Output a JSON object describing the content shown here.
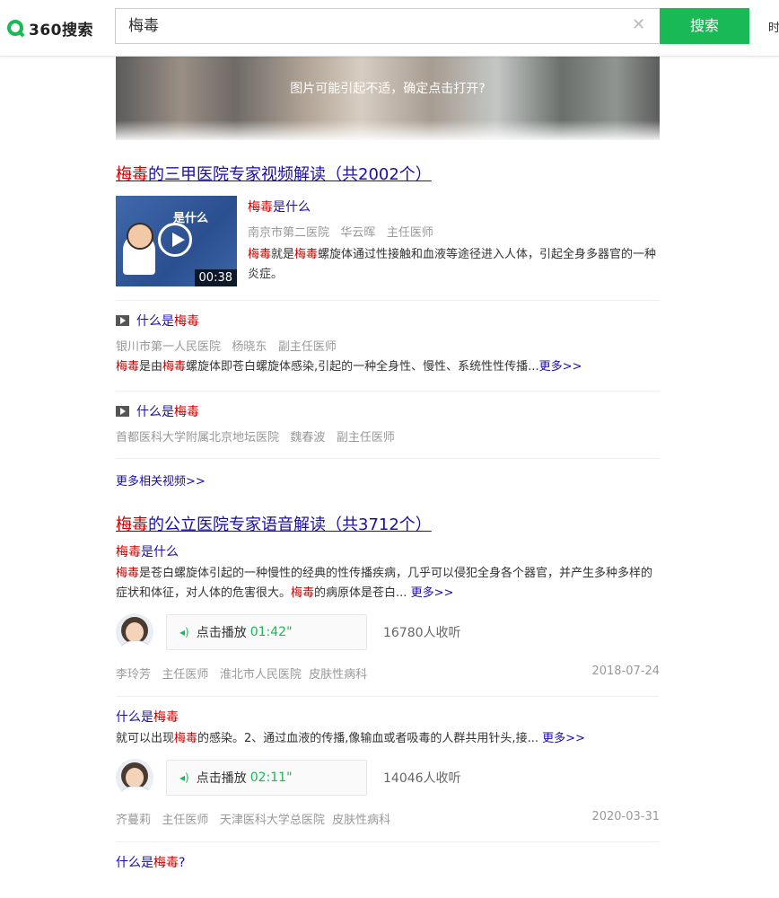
{
  "header": {
    "logo": "360搜索",
    "query": "梅毒",
    "search_button": "搜索",
    "more": "时"
  },
  "banner": {
    "warning": "图片可能引起不适，确定点击打开?"
  },
  "video_section": {
    "title_hl": "梅毒",
    "title_rest": "的三甲医院专家视频解读（共2002个）",
    "featured": {
      "thumb_title": "是什么",
      "duration": "00:38",
      "title_hl": "梅毒",
      "title_rest": "是什么",
      "hospital": "南京市第二医院",
      "doctor": "华云晖",
      "rank": "主任医师",
      "desc_hl1": "梅毒",
      "desc_t1": "就是",
      "desc_hl2": "梅毒",
      "desc_t2": "螺旋体通过性接触和血液等途径进入人体，引起全身多器官的一种炎症。"
    },
    "items": [
      {
        "title_pre": "什么是",
        "title_hl": "梅毒",
        "hospital": "银川市第一人民医院",
        "doctor": "杨晓东",
        "rank": "副主任医师",
        "desc_hl1": "梅毒",
        "desc_t1": "是由",
        "desc_hl2": "梅毒",
        "desc_t2": "螺旋体即苍白螺旋体感染,引起的一种全身性、慢性、系统性性传播...",
        "more": "更多>>"
      },
      {
        "title_pre": "什么是",
        "title_hl": "梅毒",
        "hospital": "首都医科大学附属北京地坛医院",
        "doctor": "魏春波",
        "rank": "副主任医师"
      }
    ],
    "more_videos": "更多相关视频>>"
  },
  "voice_section": {
    "title_hl": "梅毒",
    "title_rest": "的公立医院专家语音解读（共3712个）",
    "items": [
      {
        "title_hl": "梅毒",
        "title_rest": "是什么",
        "desc_hl1": "梅毒",
        "desc_t1": "是苍白螺旋体引起的一种慢性的经典的性传播疾病，几乎可以侵犯全身各个器官，并产生多种多样的症状和体征，对人体的危害很大。",
        "desc_hl2": "梅毒",
        "desc_t2": "的病原体是苍白...",
        "more": "更多>>",
        "play_label": "点击播放",
        "duration": "01:42\"",
        "listeners": "16780人收听",
        "doctor": "李玲芳",
        "rank": "主任医师",
        "hospital": "淮北市人民医院",
        "dept": "皮肤性病科",
        "date": "2018-07-24"
      },
      {
        "title_pre": "什么是",
        "title_hl": "梅毒",
        "desc_t0": "就可以出现",
        "desc_hl1": "梅毒",
        "desc_t1": "的感染。2、通过血液的传播,像输血或者吸毒的人群共用针头,接...",
        "more": "更多>>",
        "play_label": "点击播放",
        "duration": "02:11\"",
        "listeners": "14046人收听",
        "doctor": "齐蔓莉",
        "rank": "主任医师",
        "hospital": "天津医科大学总医院",
        "dept": "皮肤性病科",
        "date": "2020-03-31"
      },
      {
        "title_pre": "什么是",
        "title_hl": "梅毒",
        "title_post": "?"
      }
    ]
  },
  "colors": {
    "accent": "#19b955",
    "link": "#1a0dab",
    "highlight": "#cc0000"
  }
}
